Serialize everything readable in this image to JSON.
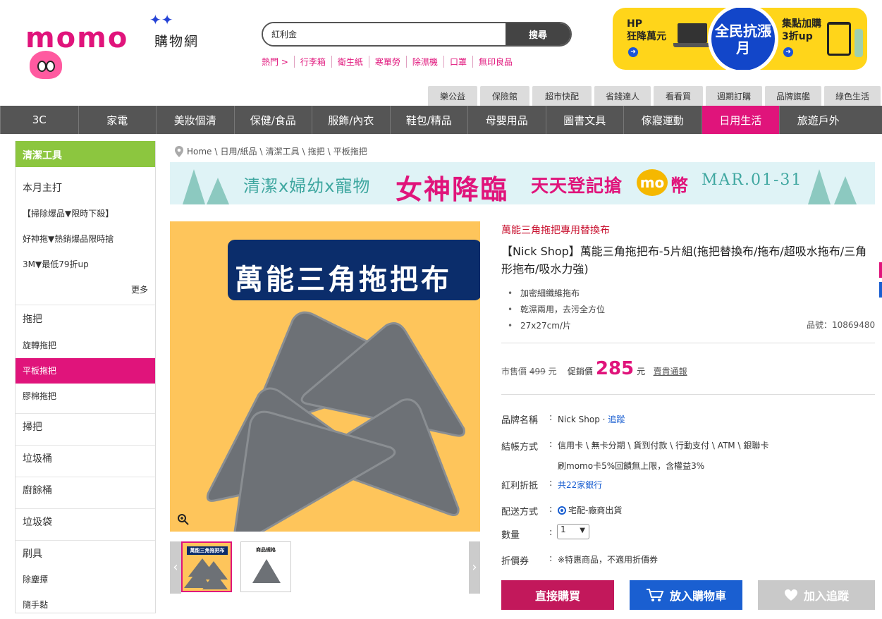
{
  "logo": {
    "text": "momo",
    "sub": "購物網"
  },
  "search": {
    "value": "紅利金",
    "button": "搜尋"
  },
  "hot_links": [
    "熱門 >",
    "行李箱",
    "衛生紙",
    "寒單勞",
    "除濕機",
    "口罩",
    "無印良品"
  ],
  "promo": {
    "left_line1": "HP",
    "left_line2": "狂降萬元",
    "center": "全民抗漲月",
    "right_line1": "集點加購",
    "right_line2": "3折up"
  },
  "top_tabs": [
    "樂公益",
    "保險館",
    "超市快配",
    "省錢達人",
    "看看買",
    "週期訂購",
    "品牌旗艦",
    "綠色生活"
  ],
  "main_nav": [
    {
      "label": "3C",
      "active": false
    },
    {
      "label": "家電",
      "active": false
    },
    {
      "label": "美妝個清",
      "active": false
    },
    {
      "label": "保健/食品",
      "active": false
    },
    {
      "label": "服飾/內衣",
      "active": false
    },
    {
      "label": "鞋包/精品",
      "active": false
    },
    {
      "label": "母嬰用品",
      "active": false
    },
    {
      "label": "圖書文具",
      "active": false
    },
    {
      "label": "傢寢運動",
      "active": false
    },
    {
      "label": "日用生活",
      "active": true
    },
    {
      "label": "旅遊戶外",
      "active": false
    }
  ],
  "sidebar": {
    "title": "清潔工具",
    "monthly": "本月主打",
    "promos": [
      "【掃除爆品▼限時下殺】",
      "好神拖▼熱銷爆品限時搶",
      "3M▼最低79折up"
    ],
    "more": "更多",
    "mop_head": "拖把",
    "mop_items": [
      "旋轉拖把",
      "平板拖把",
      "膠棉拖把"
    ],
    "cats": [
      "掃把",
      "垃圾桶",
      "廚餘桶",
      "垃圾袋",
      "刷具"
    ],
    "brush_items": [
      "除塵撢",
      "隨手黏"
    ]
  },
  "breadcrumb": [
    "Home",
    "日用/紙品",
    "清潔工具",
    "拖把",
    "平板拖把"
  ],
  "event_banner": {
    "t1": "清潔x婦幼x寵物",
    "t2": "女神降臨",
    "t3": "天天登記搶",
    "mo": "mo",
    "t3b": "幣",
    "date": "MAR.01-31"
  },
  "product_image": {
    "title": "萬能三角拖把布"
  },
  "thumbs": [
    {
      "label": "萬能三角拖把布"
    },
    {
      "label": "商品規格"
    }
  ],
  "product": {
    "subtitle": "萬能三角拖把專用替換布",
    "title": "【Nick Shop】萬能三角拖把布-5片組(拖把替換布/拖布/超吸水拖布/三角形拖布/吸水力強)",
    "bullets": [
      "加密細纖維拖布",
      "乾濕兩用，去污全方位",
      "27x27cm/片"
    ],
    "sku_label": "品號：",
    "sku": "10869480",
    "market_label": "市售價",
    "market_price": "499",
    "currency": "元",
    "sale_label": "促銷價",
    "sale_price": "285",
    "fee_notice": "賣貴通報"
  },
  "info": {
    "brand_label": "品牌名稱",
    "brand": "Nick Shop",
    "follow": "追蹤",
    "pay_label": "結帳方式",
    "pay": "信用卡 \\ 無卡分期 \\ 貨到付款 \\ 行動支付 \\ ATM \\ 銀聯卡",
    "pay_note": "刷momo卡5%回饋無上限，含權益3%",
    "bonus_label": "紅利折抵",
    "bonus": "共22家銀行",
    "ship_label": "配送方式",
    "ship": "宅配-廠商出貨",
    "qty_label": "數量",
    "qty": "1",
    "coupon_label": "折價券",
    "coupon": "※特惠商品，不適用折價券"
  },
  "buttons": {
    "buy": "直接購買",
    "cart": "放入購物車",
    "fav": "加入追蹤"
  },
  "colors": {
    "brand": "#e0147b",
    "nav": "#555555",
    "sidebar_title": "#8cc63f",
    "price": "#e0147b",
    "buy": "#c2185b",
    "cart": "#1a5fd1"
  }
}
